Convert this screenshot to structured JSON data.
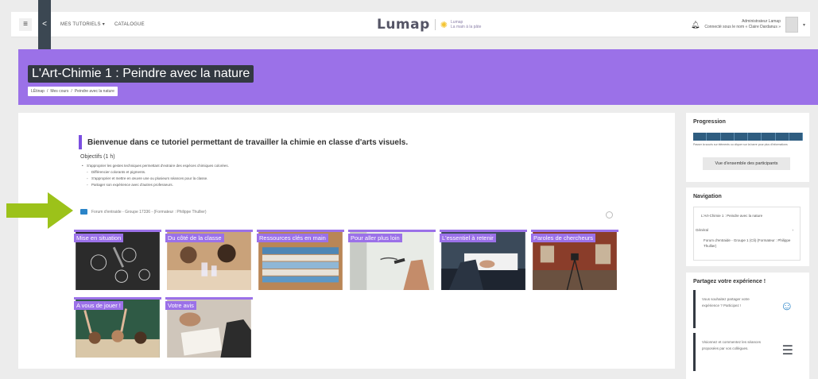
{
  "navbar": {
    "menu_icon": "hamburger-icon",
    "share_icon": "share-icon",
    "link_tutorials": "MES TUTORIELS",
    "link_catalogue": "CATALOGUE",
    "brand_name": "Lumap",
    "brand_sub_1": "Lumap",
    "brand_sub_2": "La main à la pâte",
    "user_line_1": "Administrateur Lamap",
    "user_line_2": "Connecté sous le nom « Claire Dardanus »"
  },
  "header": {
    "title": "L'Art-Chimie 1 : Peindre avec la nature",
    "breadcrumb": [
      "LÉtinap",
      "/",
      "Mes cours",
      "/",
      "Peindre avec la nature"
    ]
  },
  "main": {
    "welcome": "Bienvenue dans ce tutoriel permettant de travailler la chimie en classe d'arts visuels.",
    "objectives_title": "Objectifs (1 h)",
    "objectives": [
      {
        "level": 1,
        "text": "S'approprier les gestes techniques permettant d'extraire des espèces chimiques colorées."
      },
      {
        "level": 2,
        "text": "Différencier colorants et pigments."
      },
      {
        "level": 2,
        "text": "S'approprier et mettre en œuvre une ou plusieurs séances pour la classe."
      },
      {
        "level": 2,
        "text": "Partager son expérience avec d'autres professeurs."
      }
    ],
    "forum_link": "Forum d'entraide - Groupe 17336 - (Formateur : Philippe Thullier)",
    "tiles": [
      {
        "label": "Mise en situation"
      },
      {
        "label": "Du côté de la classe"
      },
      {
        "label": "Ressources clés en main"
      },
      {
        "label": "Pour aller plus loin"
      },
      {
        "label": "L'essentiel à retenir"
      },
      {
        "label": "Paroles de chercheurs"
      },
      {
        "label": "A vous de jouer !"
      },
      {
        "label": "Votre avis"
      }
    ]
  },
  "sidebar": {
    "progress_title": "Progression",
    "progress_note": "Passer la souris sur éléments ou cliquer sur la barre pour plus d'informations",
    "progress_button": "Vue d'ensemble des participants",
    "navigation_title": "Navigation",
    "nav_course": "L'Art-Chimie 1 : Peindre avec la nature",
    "nav_general": "Général",
    "nav_forum": "Forum d'entraide - Groupe 1 (Cli) (Formateur : Philippe Thullier)",
    "share_title": "Partagez votre expérience !",
    "share_1": "Vous souhaitez partager votre expérience ? Participez !",
    "share_2": "Visionnez et commentez les séances proposées par vos collègues."
  },
  "colors": {
    "accent_purple": "#9b71e8",
    "pointer_green": "#9cc21a",
    "progress_blue": "#2f5d80"
  }
}
